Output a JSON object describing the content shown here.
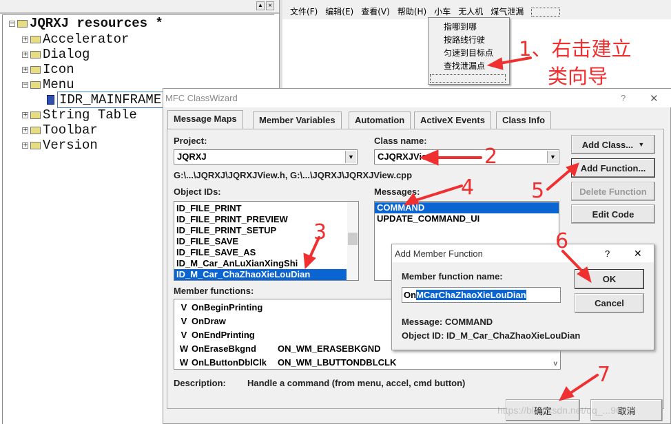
{
  "resource_tree": {
    "root": "JQRXJ resources *",
    "items": [
      {
        "label": "Accelerator",
        "expanded": false
      },
      {
        "label": "Dialog",
        "expanded": false
      },
      {
        "label": "Icon",
        "expanded": false
      },
      {
        "label": "Menu",
        "expanded": true
      },
      {
        "label": "String Table",
        "expanded": false
      },
      {
        "label": "Toolbar",
        "expanded": false
      },
      {
        "label": "Version",
        "expanded": false
      }
    ],
    "child": "IDR_MAINFRAME"
  },
  "menubar": [
    "文件(F)",
    "编辑(E)",
    "查看(V)",
    "帮助(H)",
    "小车",
    "无人机",
    "煤气泄漏"
  ],
  "dropdown": [
    "指哪到哪",
    "按路线行驶",
    "匀速到目标点",
    "查找泄漏点"
  ],
  "annotations": {
    "a1": "1、右击建立",
    "a1b": "类向导",
    "a2": "2",
    "a3": "3",
    "a4": "4",
    "a5": "5",
    "a6": "6",
    "a7": "7",
    "color": "#f03030"
  },
  "classwizard": {
    "title": "MFC ClassWizard",
    "help": "?",
    "close": "✕",
    "tabs": [
      "Message Maps",
      "Member Variables",
      "Automation",
      "ActiveX Events",
      "Class Info"
    ],
    "project_label": "Project:",
    "project": "JQRXJ",
    "class_label": "Class name:",
    "class": "CJQRXJView",
    "files": "G:\\...\\JQRXJ\\JQRXJView.h, G:\\...\\JQRXJ\\JQRXJView.cpp",
    "objids_label": "Object IDs:",
    "objids": [
      "ID_FILE_PRINT",
      "ID_FILE_PRINT_PREVIEW",
      "ID_FILE_PRINT_SETUP",
      "ID_FILE_SAVE",
      "ID_FILE_SAVE_AS",
      "ID_M_Car_AnLuXianXingShi",
      "ID_M_Car_ChaZhaoXieLouDian"
    ],
    "messages_label": "Messages:",
    "messages": [
      "COMMAND",
      "UPDATE_COMMAND_UI"
    ],
    "buttons": {
      "add_class": "Add Class...",
      "add_function": "Add Function...",
      "delete_function": "Delete Function",
      "edit_code": "Edit Code",
      "ok": "确定",
      "cancel": "取消"
    },
    "members_label": "Member functions:",
    "members": [
      {
        "type": "V",
        "name": "OnBeginPrinting",
        "map": ""
      },
      {
        "type": "V",
        "name": "OnDraw",
        "map": ""
      },
      {
        "type": "V",
        "name": "OnEndPrinting",
        "map": ""
      },
      {
        "type": "W",
        "name": "OnEraseBkgnd",
        "map": "ON_WM_ERASEBKGND"
      },
      {
        "type": "W",
        "name": "OnLButtonDblClk",
        "map": "ON_WM_LBUTTONDBLCLK"
      }
    ],
    "description_label": "Description:",
    "description": "Handle a command (from menu, accel, cmd button)"
  },
  "add_member": {
    "title": "Add Member Function",
    "help": "?",
    "close": "✕",
    "name_label": "Member function name:",
    "name_prefix": "On",
    "name_selected": "MCarChaZhaoXieLouDian",
    "ok": "OK",
    "cancel": "Cancel",
    "message": "Message: COMMAND",
    "object_id": "Object ID: ID_M_Car_ChaZhaoXieLouDian"
  },
  "watermark": "https://blog.csdn.net/qq_...9692"
}
